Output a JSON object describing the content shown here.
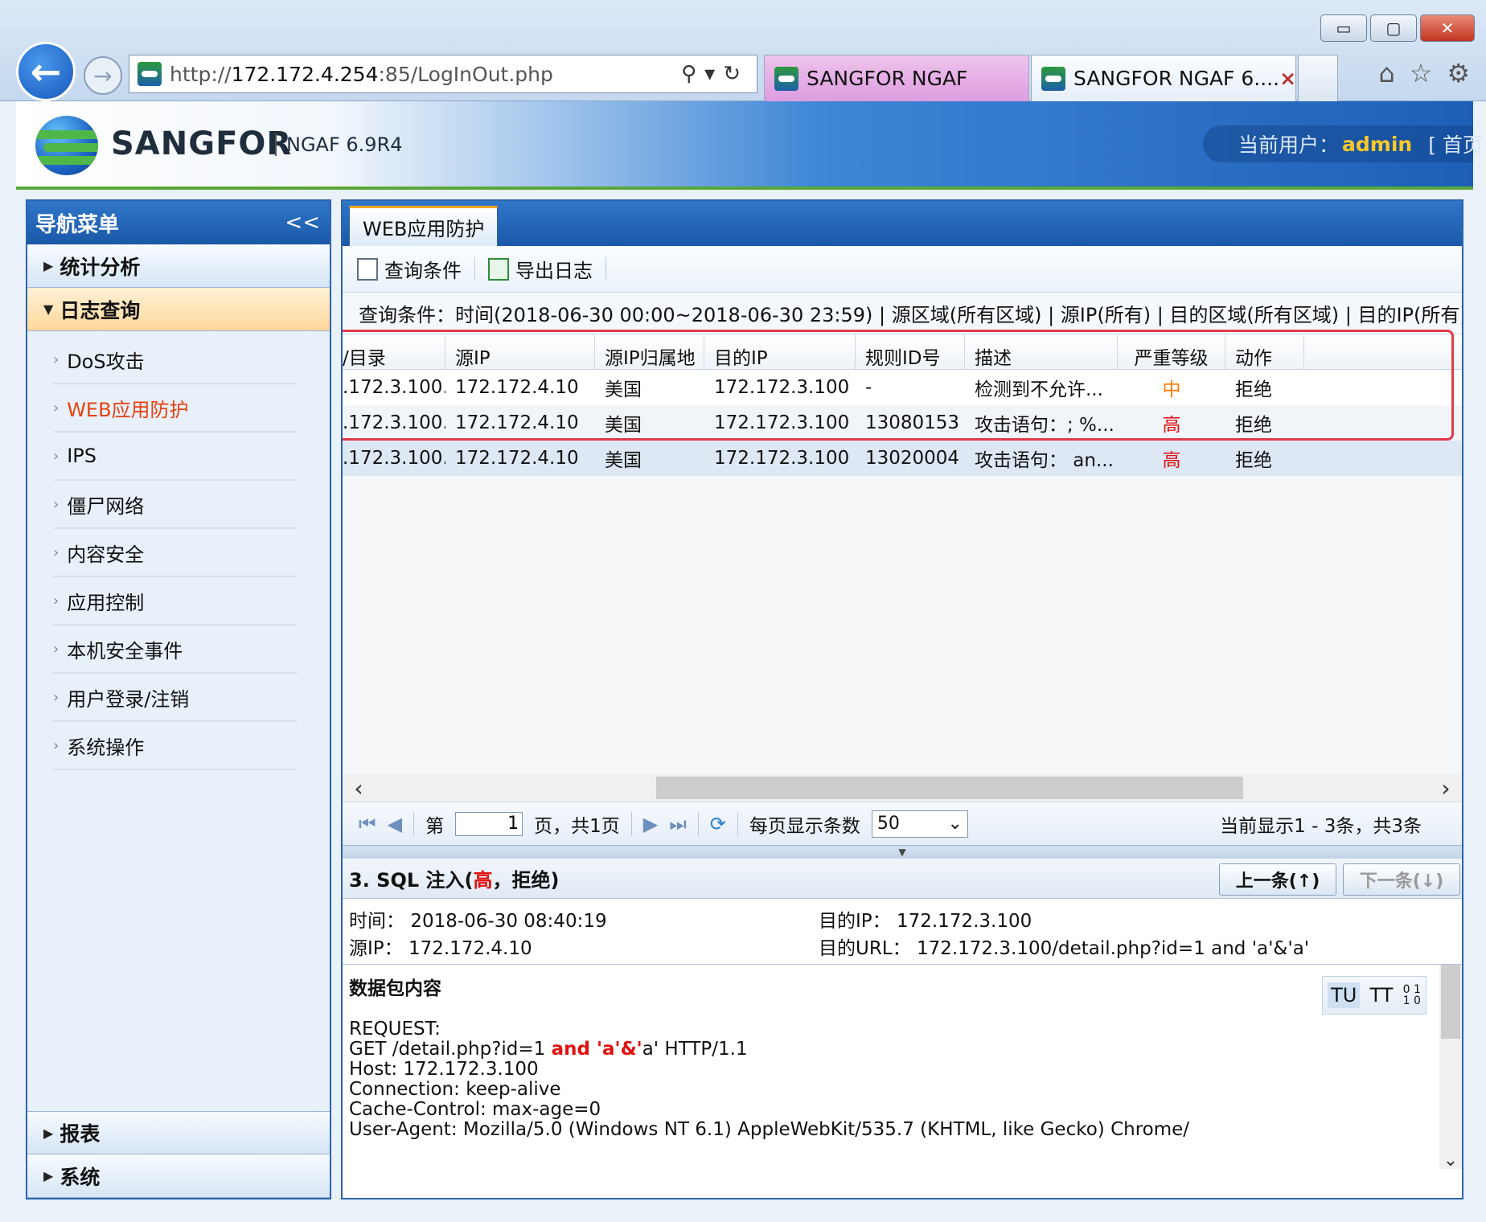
{
  "browser": {
    "window_buttons": {
      "minimize": "▭",
      "maximize": "▢",
      "close": "✕"
    },
    "address": {
      "prefix": "http://",
      "host": "172.172.4.254",
      "rest": ":85/LogInOut.php"
    },
    "tabs": [
      {
        "label": "SANGFOR NGAF"
      },
      {
        "label": "SANGFOR NGAF 6....",
        "close": "×"
      }
    ]
  },
  "app": {
    "brand": "SANGFOR",
    "version": "NGAF 6.9R4",
    "user_label": "当前用户：",
    "user_name": "admin",
    "home_link": "[ 首页"
  },
  "nav": {
    "title": "导航菜单",
    "collapse": "<<",
    "groups": [
      {
        "label": "统计分析"
      },
      {
        "label": "日志查询"
      }
    ],
    "subitems": [
      {
        "label": "DoS攻击"
      },
      {
        "label": "WEB应用防护"
      },
      {
        "label": "IPS"
      },
      {
        "label": "僵尸网络"
      },
      {
        "label": "内容安全"
      },
      {
        "label": "应用控制"
      },
      {
        "label": "本机安全事件"
      },
      {
        "label": "用户登录/注销"
      },
      {
        "label": "系统操作"
      }
    ],
    "bottom_groups": [
      {
        "label": "报表"
      },
      {
        "label": "系统"
      }
    ]
  },
  "main": {
    "tab": "WEB应用防护",
    "toolbar": {
      "query": "查询条件",
      "export": "导出日志"
    },
    "condition": "查询条件：时间(2018-06-30 00:00~2018-06-30 23:59) | 源区域(所有区域) | 源IP(所有) | 目的区域(所有区域) | 目的IP(所有) |",
    "columns": [
      "/目录",
      "源IP",
      "源IP归属地",
      "目的IP",
      "规则ID号",
      "描述",
      "严重等级",
      "动作"
    ],
    "rows": [
      {
        "dir": ".172.3.100...",
        "src_ip": "172.172.4.10",
        "src_loc": "美国",
        "dst_ip": "172.172.3.100",
        "rule_id": "-",
        "desc": "检测到不允许...",
        "severity": "中",
        "action": "拒绝"
      },
      {
        "dir": ".172.3.100...",
        "src_ip": "172.172.4.10",
        "src_loc": "美国",
        "dst_ip": "172.172.3.100",
        "rule_id": "13080153",
        "desc": "攻击语句：; %...",
        "severity": "高",
        "action": "拒绝"
      },
      {
        "dir": ".172.3.100...",
        "src_ip": "172.172.4.10",
        "src_loc": "美国",
        "dst_ip": "172.172.3.100",
        "rule_id": "13020004",
        "desc": "攻击语句： an...",
        "severity": "高",
        "action": "拒绝"
      }
    ],
    "pager": {
      "page_prefix": "第",
      "page_value": "1",
      "page_suffix": "页，共1页",
      "per_page_label": "每页显示条数",
      "per_page_value": "50",
      "status": "当前显示1 - 3条，共3条"
    },
    "detail": {
      "title_prefix": "3. SQL 注入(",
      "title_severity": "高",
      "title_suffix": "，拒绝)",
      "prev": "上一条(↑)",
      "next": "下一条(↓)",
      "time_label": "时间：",
      "time_value": "2018-06-30 08:40:19",
      "src_label": "源IP：",
      "src_value": "172.172.4.10",
      "dst_label": "目的IP：",
      "dst_value": "172.172.3.100",
      "url_label": "目的URL：",
      "url_value": "172.172.3.100/detail.php?id=1 and 'a'&'a'",
      "packet_title": "数据包内容",
      "packet": {
        "l1": "REQUEST:",
        "l2a": "GET /detail.php?id=1 ",
        "l2b": "and 'a'&'",
        "l2c": "a' HTTP/1.1",
        "l3": "Host: 172.172.3.100",
        "l4": "Connection: keep-alive",
        "l5": "Cache-Control: max-age=0",
        "l6": "User-Agent: Mozilla/5.0 (Windows NT 6.1) AppleWebKit/535.7 (KHTML, like Gecko) Chrome/"
      }
    }
  },
  "colors": {
    "accent": "#1b58a8",
    "highlight": "#e33a4a",
    "severity_high": "#e01010",
    "severity_mid": "#ff7a00"
  }
}
